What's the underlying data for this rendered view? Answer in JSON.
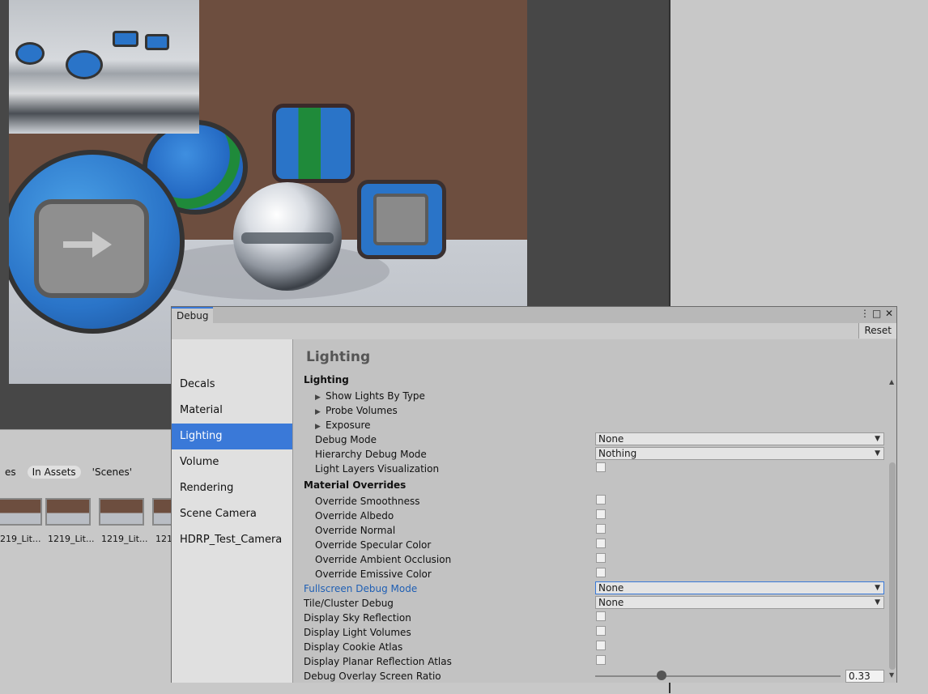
{
  "project": {
    "search_tabs": [
      {
        "label": "es"
      },
      {
        "label": "In Assets"
      },
      {
        "label": "'Scenes'"
      }
    ],
    "assets": [
      {
        "label": "219_Lit..."
      },
      {
        "label": "1219_Lit..."
      },
      {
        "label": "1219_Lit..."
      },
      {
        "label": "121"
      }
    ]
  },
  "debug": {
    "tab_title": "Debug",
    "menu_icon": "⋮",
    "maximize_icon": "□",
    "close_icon": "✕",
    "reset_label": "Reset",
    "sidebar": [
      {
        "label": "Decals"
      },
      {
        "label": "Material"
      },
      {
        "label": "Lighting",
        "active": true
      },
      {
        "label": "Volume"
      },
      {
        "label": "Rendering"
      },
      {
        "label": "Scene Camera"
      },
      {
        "label": "HDRP_Test_Camera"
      }
    ],
    "panel_title": "Lighting",
    "lighting_section": "Lighting",
    "foldouts": [
      {
        "label": "Show Lights By Type"
      },
      {
        "label": "Probe Volumes"
      },
      {
        "label": "Exposure"
      }
    ],
    "debug_mode": {
      "label": "Debug Mode",
      "value": "None"
    },
    "hierarchy_debug_mode": {
      "label": "Hierarchy Debug Mode",
      "value": "Nothing"
    },
    "light_layers_visualization": {
      "label": "Light Layers Visualization",
      "checked": false
    },
    "material_overrides_heading": "Material Overrides",
    "overrides": [
      {
        "label": "Override Smoothness",
        "checked": false
      },
      {
        "label": "Override Albedo",
        "checked": false
      },
      {
        "label": "Override Normal",
        "checked": false
      },
      {
        "label": "Override Specular Color",
        "checked": false
      },
      {
        "label": "Override Ambient Occlusion",
        "checked": false
      },
      {
        "label": "Override Emissive Color",
        "checked": false
      }
    ],
    "fullscreen_debug_mode": {
      "label": "Fullscreen Debug Mode",
      "value": "None"
    },
    "tile_cluster_debug": {
      "label": "Tile/Cluster Debug",
      "value": "None"
    },
    "display_toggles": [
      {
        "label": "Display Sky Reflection",
        "checked": false
      },
      {
        "label": "Display Light Volumes",
        "checked": false
      },
      {
        "label": "Display Cookie Atlas",
        "checked": false
      },
      {
        "label": "Display Planar Reflection Atlas",
        "checked": false
      }
    ],
    "overlay_ratio": {
      "label": "Debug Overlay Screen Ratio",
      "value": "0.33",
      "fraction": 0.33
    }
  },
  "colors": {
    "accent": "#3a79d8",
    "highlight_text": "#1f5fb4"
  }
}
